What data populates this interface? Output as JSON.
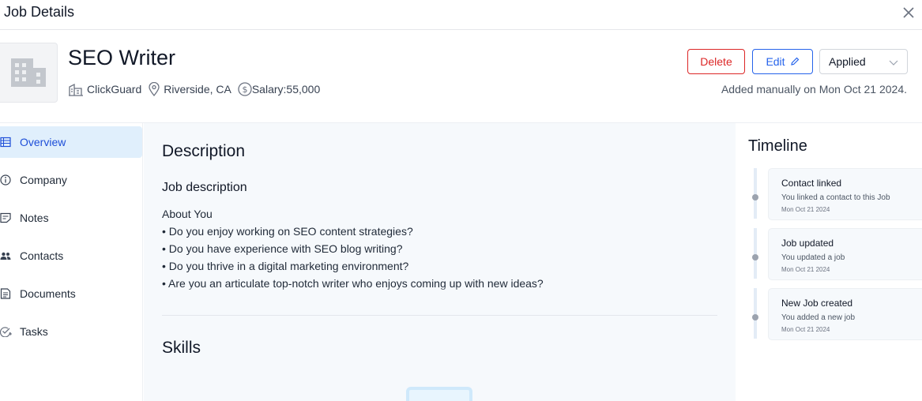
{
  "modal": {
    "title": "Job Details"
  },
  "job": {
    "title": "SEO Writer",
    "company": "ClickGuard",
    "location": "Riverside, CA",
    "salary": "Salary:55,000",
    "added": "Added manually on Mon Oct 21 2024."
  },
  "actions": {
    "delete": "Delete",
    "edit": "Edit",
    "status": "Applied"
  },
  "sidebar": {
    "items": [
      {
        "label": "Overview",
        "icon": "list-icon"
      },
      {
        "label": "Company",
        "icon": "info-icon"
      },
      {
        "label": "Notes",
        "icon": "note-icon"
      },
      {
        "label": "Contacts",
        "icon": "users-icon"
      },
      {
        "label": "Documents",
        "icon": "document-icon"
      },
      {
        "label": "Tasks",
        "icon": "task-check-icon"
      }
    ]
  },
  "main": {
    "heading": "Description",
    "subheading": "Job description",
    "lines": [
      "About You",
      "• Do you enjoy working on SEO content strategies?",
      "• Do you have experience with SEO blog writing?",
      "• Do you thrive in a digital marketing environment?",
      "• Are you an articulate top-notch writer who enjoys coming up with new ideas?"
    ],
    "skills_heading": "Skills"
  },
  "timeline": {
    "title": "Timeline",
    "events": [
      {
        "title": "Contact linked",
        "text": "You linked a contact to this Job",
        "date": "Mon Oct 21 2024"
      },
      {
        "title": "Job updated",
        "text": "You updated a job",
        "date": "Mon Oct 21 2024"
      },
      {
        "title": "New Job created",
        "text": "You added a new job",
        "date": "Mon Oct 21 2024"
      }
    ]
  },
  "colors": {
    "accent": "#2563eb",
    "danger": "#dc2626",
    "active_bg": "#e0effc"
  }
}
